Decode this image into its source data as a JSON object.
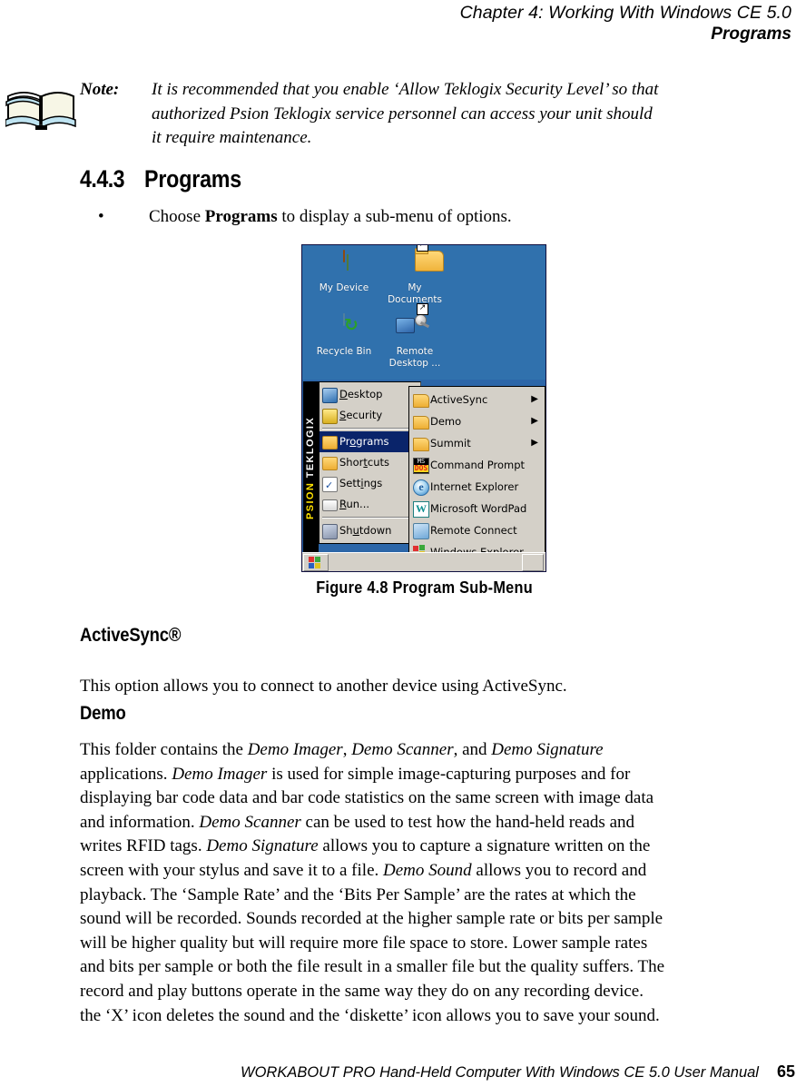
{
  "running_head": {
    "chapter_line": "Chapter  4:  Working With Windows CE 5.0",
    "section_line": "Programs"
  },
  "note": {
    "icon": "open-book-icon",
    "label": "Note:",
    "lines": [
      "It is recommended that you enable ‘Allow Teklogix Security Level’ so that",
      "authorized Psion Teklogix service personnel can access your unit should",
      "it require maintenance."
    ]
  },
  "section": {
    "number": "4.4.3",
    "title": "Programs"
  },
  "bullet": {
    "marker": "•",
    "prefix": "Choose ",
    "bold": "Programs",
    "suffix": " to display a sub-menu of options."
  },
  "screenshot": {
    "desktop_bg": "#3071ad",
    "icons": [
      {
        "name": "my-device",
        "label_lines": [
          "My Device"
        ],
        "icon": "handheld-device-icon",
        "shortcut": false
      },
      {
        "name": "my-documents",
        "label_lines": [
          "My",
          "Documents"
        ],
        "icon": "folder-icon",
        "shortcut": true
      },
      {
        "name": "recycle-bin",
        "label_lines": [
          "Recycle Bin"
        ],
        "icon": "recycle-bin-icon",
        "shortcut": false
      },
      {
        "name": "remote-desktop",
        "label_lines": [
          "Remote",
          "Desktop ..."
        ],
        "icon": "remote-desktop-icon",
        "shortcut": true
      }
    ],
    "strip": {
      "top_text": "TEKLOGIX",
      "bottom_text": "PSION",
      "bg": "#000000",
      "psion_color": "#ffe200"
    },
    "start_menu": {
      "selected": "Programs",
      "selection_color": "#0a246a",
      "items": [
        {
          "label_pre": "",
          "label_accel": "D",
          "label_post": "esktop",
          "icon": "desktop-icon",
          "selected": false,
          "sep_after": false
        },
        {
          "label_pre": "",
          "label_accel": "S",
          "label_post": "ecurity",
          "icon": "lock-icon",
          "selected": false,
          "sep_after": true
        },
        {
          "label_pre": "Pr",
          "label_accel": "o",
          "label_post": "grams",
          "icon": "programs-folder-icon",
          "selected": true,
          "sep_after": false
        },
        {
          "label_pre": "Shor",
          "label_accel": "t",
          "label_post": "cuts",
          "icon": "shortcuts-folder-icon",
          "selected": false,
          "sep_after": false
        },
        {
          "label_pre": "Sett",
          "label_accel": "i",
          "label_post": "ngs",
          "icon": "settings-icon",
          "selected": false,
          "sep_after": false
        },
        {
          "label_pre": "",
          "label_accel": "R",
          "label_post": "un...",
          "icon": "run-icon",
          "selected": false,
          "sep_after": true
        },
        {
          "label_pre": "Sh",
          "label_accel": "u",
          "label_post": "tdown",
          "icon": "shutdown-icon",
          "selected": false,
          "sep_after": false
        }
      ]
    },
    "sub_menu": {
      "items": [
        {
          "label": "ActiveSync",
          "icon": "folder-icon",
          "submenu_arrow": "▶"
        },
        {
          "label": "Demo",
          "icon": "folder-icon",
          "submenu_arrow": "▶"
        },
        {
          "label": "Summit",
          "icon": "folder-icon",
          "submenu_arrow": "▶"
        },
        {
          "label": "Command Prompt",
          "icon": "command-prompt-icon",
          "submenu_arrow": ""
        },
        {
          "label": "Internet Explorer",
          "icon": "internet-explorer-icon",
          "submenu_arrow": ""
        },
        {
          "label": "Microsoft WordPad",
          "icon": "wordpad-icon",
          "submenu_arrow": ""
        },
        {
          "label": "Remote Connect",
          "icon": "remote-connect-icon",
          "submenu_arrow": ""
        },
        {
          "label": "Windows Explorer",
          "icon": "windows-explorer-icon",
          "submenu_arrow": ""
        }
      ]
    },
    "taskbar": {
      "start_button": "windows-flag-icon",
      "tray": "tray-icon"
    }
  },
  "figure_caption": "Figure  4.8  Program Sub-Menu",
  "activesync": {
    "heading": "ActiveSync®",
    "lines": [
      "This option allows you to connect to another device using ActiveSync."
    ]
  },
  "demo": {
    "heading": "Demo",
    "lines": [
      [
        {
          "t": "This folder contains the "
        },
        {
          "t": "Demo Imager",
          "i": true
        },
        {
          "t": ", "
        },
        {
          "t": "Demo Scanner",
          "i": true
        },
        {
          "t": ", and "
        },
        {
          "t": "Demo Signature",
          "i": true
        }
      ],
      [
        {
          "t": "applications. "
        },
        {
          "t": "Demo Imager",
          "i": true
        },
        {
          "t": " is used for simple image-capturing purposes and for"
        }
      ],
      [
        {
          "t": "displaying bar code data and bar code statistics on the same screen with image data"
        }
      ],
      [
        {
          "t": "and information. "
        },
        {
          "t": "Demo Scanner",
          "i": true
        },
        {
          "t": " can be used to test how the hand-held reads and"
        }
      ],
      [
        {
          "t": "writes RFID tags. "
        },
        {
          "t": "Demo Signature",
          "i": true
        },
        {
          "t": " allows you to capture a signature written on the"
        }
      ],
      [
        {
          "t": "screen with your stylus and save it to a file. "
        },
        {
          "t": "Demo Sound",
          "i": true
        },
        {
          "t": " allows you to record and"
        }
      ],
      [
        {
          "t": "playback. The ‘Sample Rate’ and the ‘Bits Per Sample’ are the rates at which the"
        }
      ],
      [
        {
          "t": "sound will be recorded. Sounds recorded at the higher sample rate or bits per sample"
        }
      ],
      [
        {
          "t": "will be higher quality but will require more file space to store. Lower sample rates"
        }
      ],
      [
        {
          "t": "and bits per sample or both the file result in a smaller file but the quality suffers. The"
        }
      ],
      [
        {
          "t": "record and play buttons operate in the same way they do on any recording device."
        }
      ],
      [
        {
          "t": "the ‘X’ icon deletes the sound and the ‘diskette’ icon allows you to save your sound."
        }
      ]
    ]
  },
  "footer": {
    "text": "WORKABOUT PRO Hand-Held Computer With Windows CE 5.0 User Manual",
    "page": "65"
  }
}
